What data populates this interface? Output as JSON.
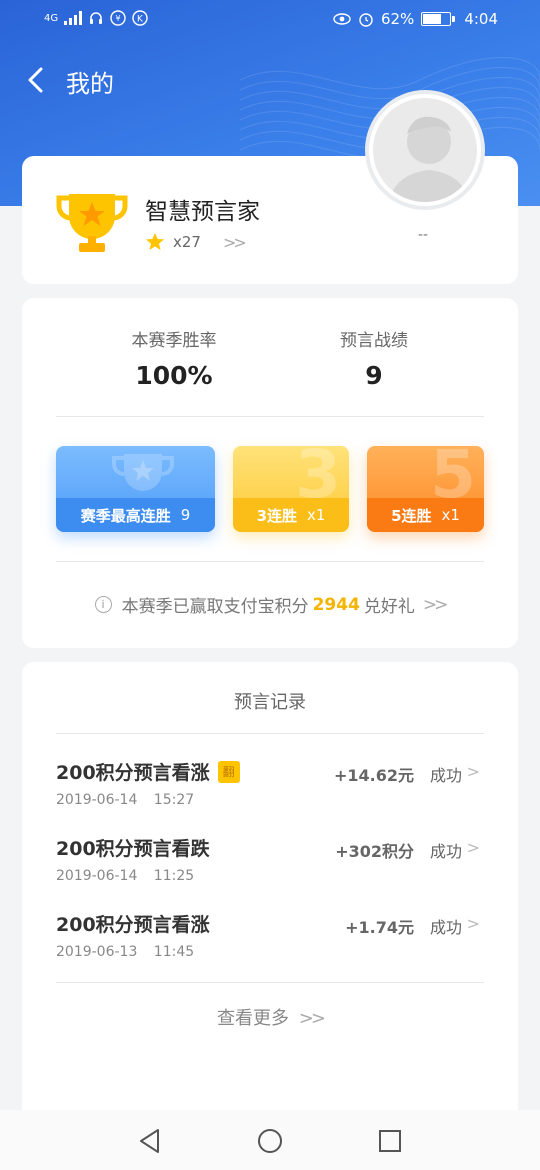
{
  "status_bar": {
    "network": "4G",
    "battery": "62%",
    "time": "4:04"
  },
  "nav": {
    "title": "我的"
  },
  "profile": {
    "title": "智慧预言家",
    "star_count": "x27",
    "nickname": "--"
  },
  "stats": {
    "win_rate_label": "本赛季胜率",
    "win_rate_value": "100%",
    "record_label": "预言战绩",
    "record_value": "9"
  },
  "badges": [
    {
      "label": "赛季最高连胜",
      "value": "9",
      "ghost": ""
    },
    {
      "label": "3连胜",
      "value": "x1",
      "ghost": "3"
    },
    {
      "label": "5连胜",
      "value": "x1",
      "ghost": "5"
    }
  ],
  "points_line": {
    "prefix": "本赛季已赢取支付宝积分",
    "number": "2944",
    "suffix": "兑好礼"
  },
  "records": {
    "title": "预言记录",
    "items": [
      {
        "title": "200积分预言看涨",
        "tag": "翻",
        "date": "2019-06-14 15:27",
        "amount": "+14.62元",
        "status": "成功"
      },
      {
        "title": "200积分预言看跌",
        "tag": "",
        "date": "2019-06-14 11:25",
        "amount": "+302积分",
        "status": "成功"
      },
      {
        "title": "200积分预言看涨",
        "tag": "",
        "date": "2019-06-13 11:45",
        "amount": "+1.74元",
        "status": "成功"
      }
    ],
    "view_more": "查看更多"
  },
  "colors": {
    "header_blue": "#2a63d6",
    "accent_yellow": "#f5b400",
    "badge_blue": "#4d9bf7",
    "badge_yellow": "#ffc933",
    "badge_orange": "#ff8a25"
  }
}
